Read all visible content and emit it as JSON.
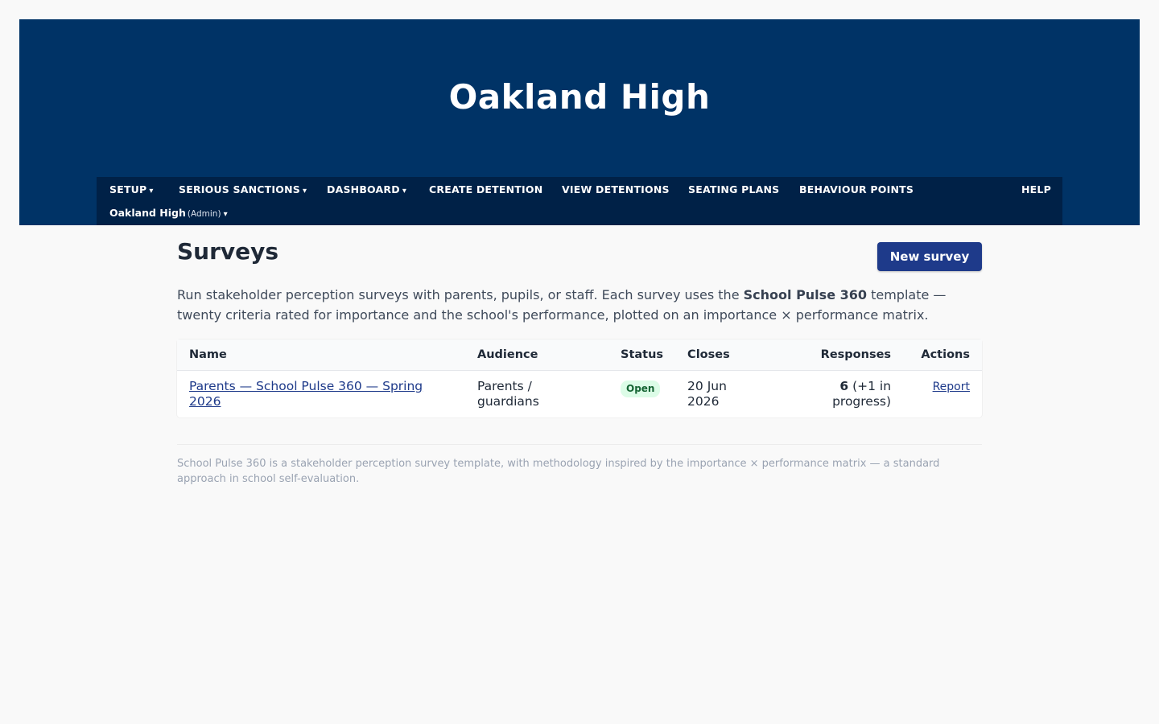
{
  "header": {
    "school_name": "Oakland High"
  },
  "nav": {
    "items": [
      {
        "label": "SETUP",
        "dropdown": true
      },
      {
        "label": "SERIOUS SANCTIONS",
        "dropdown": true
      },
      {
        "label": "DASHBOARD",
        "dropdown": true
      },
      {
        "label": "CREATE DETENTION",
        "dropdown": false
      },
      {
        "label": "VIEW DETENTIONS",
        "dropdown": false
      },
      {
        "label": "SEATING PLANS",
        "dropdown": false
      },
      {
        "label": "BEHAVIOUR POINTS",
        "dropdown": false
      }
    ],
    "help": "HELP",
    "school": "Oakland High",
    "role": "(Admin)",
    "caret": "▾"
  },
  "page": {
    "title": "Surveys",
    "new_button": "New survey",
    "intro_before": "Run stakeholder perception surveys with parents, pupils, or staff. Each survey uses the ",
    "intro_bold": "School Pulse 360",
    "intro_after": " template — twenty criteria rated for importance and the school's performance, plotted on an importance × performance matrix."
  },
  "table": {
    "headers": {
      "name": "Name",
      "audience": "Audience",
      "status": "Status",
      "closes": "Closes",
      "responses": "Responses",
      "actions": "Actions"
    },
    "rows": [
      {
        "name": "Parents — School Pulse 360 — Spring 2026",
        "audience": "Parents / guardians",
        "status": "Open",
        "closes": "20 Jun 2026",
        "responses_count": "6",
        "responses_extra": "(+1 in progress)",
        "action": "Report"
      }
    ]
  },
  "footer": {
    "text": "School Pulse 360 is a stakeholder perception survey template, with methodology inspired by the importance × performance matrix — a standard approach in school self-evaluation."
  },
  "colors": {
    "banner": "#003366",
    "nav": "#002147",
    "primary": "#1e3a8a",
    "badge_bg": "#dcfce7",
    "badge_text": "#166534"
  }
}
